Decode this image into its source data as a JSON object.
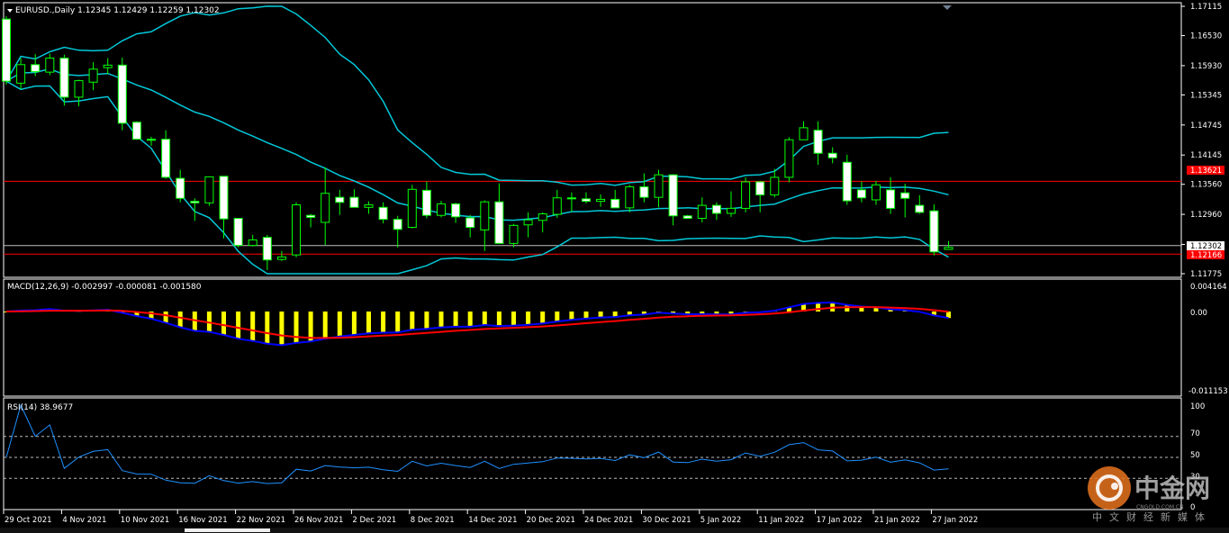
{
  "symbol_header": {
    "label": "EURUSD.,Daily",
    "open": "1.12345",
    "high": "1.12429",
    "low": "1.12259",
    "close": "1.12302"
  },
  "price_axis": [
    "1.17115",
    "1.16530",
    "1.15930",
    "1.15345",
    "1.14745",
    "1.14145",
    "1.13560",
    "1.12960",
    "1.12360",
    "1.11775"
  ],
  "price_labels": {
    "red_line_1": "1.13621",
    "current_price": "1.12302",
    "red_line_2": "1.12166"
  },
  "macd": {
    "label": "MACD(12,26,9) -0.002997 -0.000081 -0.001580",
    "axis": [
      "0.004164",
      "0.00",
      "-0.011153"
    ]
  },
  "rsi": {
    "label": "RSI(14) 38.9677",
    "axis": [
      "100",
      "70",
      "50",
      "30",
      "0"
    ]
  },
  "date_axis": [
    "29 Oct 2021",
    "4 Nov 2021",
    "10 Nov 2021",
    "16 Nov 2021",
    "22 Nov 2021",
    "26 Nov 2021",
    "2 Dec 2021",
    "8 Dec 2021",
    "14 Dec 2021",
    "20 Dec 2021",
    "24 Dec 2021",
    "30 Dec 2021",
    "5 Jan 2022",
    "11 Jan 2022",
    "17 Jan 2022",
    "21 Jan 2022",
    "27 Jan 2022"
  ],
  "watermark": {
    "brand": "中金网",
    "domain": "CNGOLD.COM.CN",
    "tagline": "中文财经新媒体"
  },
  "colors": {
    "background": "#000000",
    "bull_candle": "#000000",
    "bear_candle": "#ffffff",
    "wick": "#00ff00",
    "bollinger": "#00c8d8",
    "support_line": "#ff0000",
    "macd_hist": "#ffff00",
    "macd_main": "#0000ff",
    "macd_signal": "#ff0000",
    "rsi_line": "#1e90ff",
    "watermark": "#ff8c00"
  },
  "chart_data": {
    "type": "candlestick",
    "x": [
      "29 Oct 2021",
      "1 Nov 2021",
      "2 Nov 2021",
      "3 Nov 2021",
      "4 Nov 2021",
      "5 Nov 2021",
      "8 Nov 2021",
      "9 Nov 2021",
      "10 Nov 2021",
      "11 Nov 2021",
      "12 Nov 2021",
      "15 Nov 2021",
      "16 Nov 2021",
      "17 Nov 2021",
      "18 Nov 2021",
      "19 Nov 2021",
      "22 Nov 2021",
      "23 Nov 2021",
      "24 Nov 2021",
      "25 Nov 2021",
      "26 Nov 2021",
      "29 Nov 2021",
      "30 Nov 2021",
      "1 Dec 2021",
      "2 Dec 2021",
      "3 Dec 2021",
      "6 Dec 2021",
      "7 Dec 2021",
      "8 Dec 2021",
      "9 Dec 2021",
      "10 Dec 2021",
      "13 Dec 2021",
      "14 Dec 2021",
      "15 Dec 2021",
      "16 Dec 2021",
      "17 Dec 2021",
      "20 Dec 2021",
      "21 Dec 2021",
      "22 Dec 2021",
      "23 Dec 2021",
      "24 Dec 2021",
      "27 Dec 2021",
      "28 Dec 2021",
      "29 Dec 2021",
      "30 Dec 2021",
      "31 Dec 2021",
      "3 Jan 2022",
      "4 Jan 2022",
      "5 Jan 2022",
      "6 Jan 2022",
      "7 Jan 2022",
      "10 Jan 2022",
      "11 Jan 2022",
      "12 Jan 2022",
      "13 Jan 2022",
      "14 Jan 2022",
      "17 Jan 2022",
      "18 Jan 2022",
      "19 Jan 2022",
      "20 Jan 2022",
      "21 Jan 2022",
      "24 Jan 2022",
      "25 Jan 2022",
      "26 Jan 2022",
      "27 Jan 2022"
    ],
    "ohlc": [
      [
        1.1686,
        1.1692,
        1.1555,
        1.1562
      ],
      [
        1.1558,
        1.1608,
        1.1546,
        1.1595
      ],
      [
        1.1595,
        1.1616,
        1.1572,
        1.1581
      ],
      [
        1.158,
        1.1617,
        1.1574,
        1.1608
      ],
      [
        1.1608,
        1.1615,
        1.1513,
        1.153
      ],
      [
        1.153,
        1.1565,
        1.1512,
        1.1563
      ],
      [
        1.156,
        1.16,
        1.1544,
        1.1586
      ],
      [
        1.1589,
        1.1608,
        1.1576,
        1.1594
      ],
      [
        1.1594,
        1.1609,
        1.1464,
        1.1478
      ],
      [
        1.148,
        1.1482,
        1.1445,
        1.1446
      ],
      [
        1.1446,
        1.1451,
        1.1433,
        1.1444
      ],
      [
        1.1446,
        1.1464,
        1.1367,
        1.137
      ],
      [
        1.1368,
        1.1385,
        1.132,
        1.1328
      ],
      [
        1.1322,
        1.1328,
        1.1283,
        1.1319
      ],
      [
        1.1319,
        1.1372,
        1.1313,
        1.1371
      ],
      [
        1.1372,
        1.1372,
        1.1248,
        1.1287
      ],
      [
        1.1288,
        1.1289,
        1.123,
        1.1234
      ],
      [
        1.1234,
        1.1255,
        1.1232,
        1.1245
      ],
      [
        1.125,
        1.1255,
        1.1185,
        1.1205
      ],
      [
        1.1206,
        1.1223,
        1.1203,
        1.1211
      ],
      [
        1.1215,
        1.132,
        1.121,
        1.1315
      ],
      [
        1.1294,
        1.1297,
        1.127,
        1.129
      ],
      [
        1.128,
        1.139,
        1.1235,
        1.1338
      ],
      [
        1.133,
        1.1345,
        1.1295,
        1.132
      ],
      [
        1.133,
        1.1346,
        1.1318,
        1.131
      ],
      [
        1.131,
        1.1322,
        1.1297,
        1.1315
      ],
      [
        1.131,
        1.132,
        1.1278,
        1.1286
      ],
      [
        1.1286,
        1.1293,
        1.123,
        1.1266
      ],
      [
        1.127,
        1.1355,
        1.1268,
        1.1346
      ],
      [
        1.1344,
        1.1362,
        1.1288,
        1.1294
      ],
      [
        1.1294,
        1.1323,
        1.129,
        1.1317
      ],
      [
        1.1317,
        1.1319,
        1.1279,
        1.1291
      ],
      [
        1.1289,
        1.1295,
        1.125,
        1.127
      ],
      [
        1.1265,
        1.1324,
        1.1223,
        1.1321
      ],
      [
        1.1321,
        1.1358,
        1.1275,
        1.1238
      ],
      [
        1.1238,
        1.1277,
        1.123,
        1.1274
      ],
      [
        1.1275,
        1.13,
        1.125,
        1.1285
      ],
      [
        1.1284,
        1.13,
        1.126,
        1.1297
      ],
      [
        1.1296,
        1.1345,
        1.1289,
        1.1329
      ],
      [
        1.1329,
        1.134,
        1.1301,
        1.1327
      ],
      [
        1.1327,
        1.134,
        1.1318,
        1.1322
      ],
      [
        1.1322,
        1.1336,
        1.1311,
        1.1326
      ],
      [
        1.1326,
        1.1345,
        1.1315,
        1.1309
      ],
      [
        1.1309,
        1.1355,
        1.13,
        1.1351
      ],
      [
        1.1351,
        1.1378,
        1.132,
        1.133
      ],
      [
        1.133,
        1.1385,
        1.131,
        1.1375
      ],
      [
        1.1375,
        1.1376,
        1.1274,
        1.1293
      ],
      [
        1.1293,
        1.1295,
        1.1288,
        1.1288
      ],
      [
        1.1288,
        1.133,
        1.128,
        1.1314
      ],
      [
        1.1314,
        1.132,
        1.1285,
        1.1298
      ],
      [
        1.1298,
        1.1342,
        1.1291,
        1.1308
      ],
      [
        1.1308,
        1.137,
        1.13,
        1.1361
      ],
      [
        1.1361,
        1.1363,
        1.13,
        1.1335
      ],
      [
        1.1335,
        1.1387,
        1.133,
        1.137
      ],
      [
        1.137,
        1.145,
        1.136,
        1.1445
      ],
      [
        1.1445,
        1.1482,
        1.1447,
        1.1469
      ],
      [
        1.1464,
        1.1482,
        1.1395,
        1.1418
      ],
      [
        1.1418,
        1.143,
        1.1398,
        1.1409
      ],
      [
        1.14,
        1.1415,
        1.1315,
        1.1323
      ],
      [
        1.1345,
        1.1362,
        1.132,
        1.1329
      ],
      [
        1.1325,
        1.1363,
        1.1315,
        1.1355
      ],
      [
        1.1345,
        1.137,
        1.1297,
        1.1308
      ],
      [
        1.1339,
        1.1357,
        1.129,
        1.1328
      ],
      [
        1.1314,
        1.1334,
        1.1297,
        1.13
      ],
      [
        1.1303,
        1.1316,
        1.1214,
        1.1221
      ],
      [
        1.1226,
        1.1243,
        1.1226,
        1.123
      ]
    ],
    "horizontal_lines": [
      1.13621,
      1.12166
    ],
    "ylim": [
      1.11775,
      1.17115
    ]
  }
}
